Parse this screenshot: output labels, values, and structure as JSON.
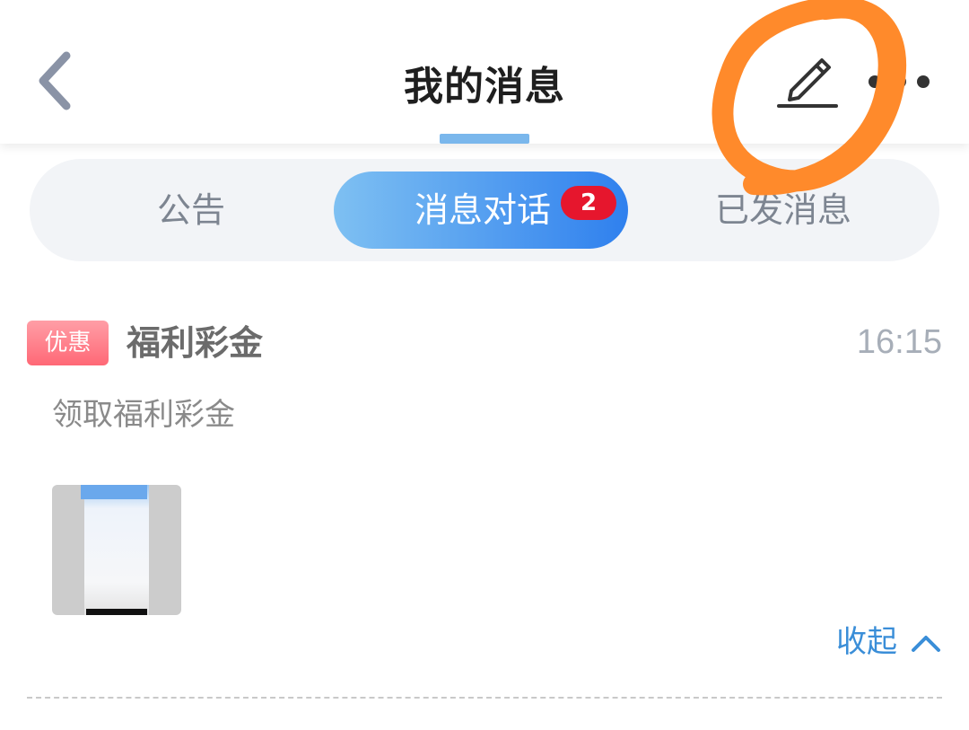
{
  "header": {
    "title": "我的消息",
    "back_icon": "chevron-left-icon",
    "edit_icon": "pencil-icon",
    "more_icon": "more-horizontal-icon"
  },
  "tabs": [
    {
      "label": "公告",
      "active": false
    },
    {
      "label": "消息对话",
      "active": true,
      "badge": "2"
    },
    {
      "label": "已发消息",
      "active": false
    }
  ],
  "message": {
    "tag": "优惠",
    "title": "福利彩金",
    "time": "16:15",
    "body": "领取福利彩金",
    "collapse_label": "收起"
  },
  "colors": {
    "accent": "#2f80ee",
    "badge": "#e6162d",
    "tag": "#ff6876",
    "annotation": "#ff8a2b"
  }
}
